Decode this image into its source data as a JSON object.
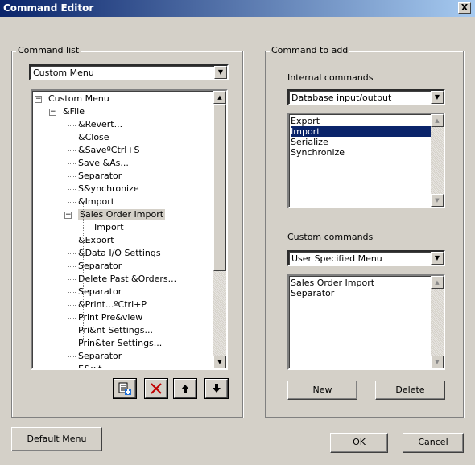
{
  "window": {
    "title": "Command Editor",
    "close_glyph": "X"
  },
  "command_list": {
    "legend": "Command list",
    "menu_combo_value": "Custom Menu",
    "tree": [
      {
        "label": "Custom Menu",
        "expanded": true
      },
      {
        "label": "&File",
        "expanded": true
      },
      {
        "label": "&Revert..."
      },
      {
        "label": "&Close"
      },
      {
        "label": "&SaveºCtrl+S"
      },
      {
        "label": "Save &As..."
      },
      {
        "label": "Separator"
      },
      {
        "label": "S&ynchronize"
      },
      {
        "label": "&Import"
      },
      {
        "label": "Sales Order Import",
        "expanded": true,
        "highlighted": true
      },
      {
        "label": "Import"
      },
      {
        "label": "&Export"
      },
      {
        "label": "&Data I/O Settings"
      },
      {
        "label": "Separator"
      },
      {
        "label": "Delete Past &Orders..."
      },
      {
        "label": "Separator"
      },
      {
        "label": "&Print...ºCtrl+P"
      },
      {
        "label": "Print Pre&view"
      },
      {
        "label": "Pri&nt Settings..."
      },
      {
        "label": "Prin&ter Settings..."
      },
      {
        "label": "Separator"
      },
      {
        "label": "E&xit"
      }
    ],
    "toolbar_icons": [
      "add-command-icon",
      "delete-x-icon",
      "move-up-icon",
      "move-down-icon"
    ]
  },
  "command_to_add": {
    "legend": "Command to add",
    "internal_label": "Internal commands",
    "internal_combo_value": "Database input/output",
    "internal_items": [
      {
        "label": "Export",
        "selected": false
      },
      {
        "label": "Import",
        "selected": true
      },
      {
        "label": "Serialize",
        "selected": false
      },
      {
        "label": "Synchronize",
        "selected": false
      }
    ],
    "custom_label": "Custom commands",
    "custom_combo_value": "User Specified Menu",
    "custom_items": [
      {
        "label": "Sales Order Import"
      },
      {
        "label": "Separator"
      }
    ],
    "new_button": "New",
    "delete_button": "Delete"
  },
  "footer": {
    "default_menu_button": "Default Menu",
    "ok_button": "OK",
    "cancel_button": "Cancel"
  },
  "colors": {
    "selection": "#0a246a",
    "face": "#d4d0c8",
    "delete_icon": "#c00000"
  }
}
